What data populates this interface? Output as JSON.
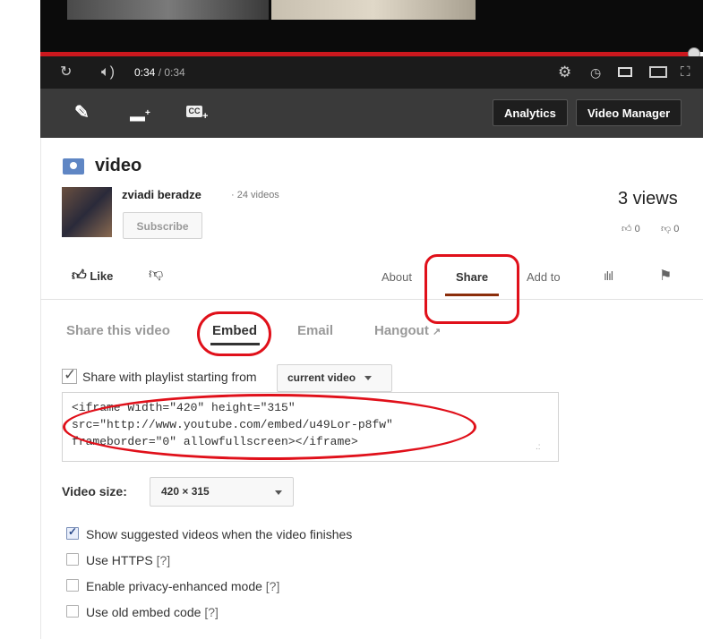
{
  "player": {
    "current_time": "0:34",
    "separator": " / ",
    "duration": "0:34",
    "progress_fraction": 1.0
  },
  "creator_bar": {
    "analytics_label": "Analytics",
    "video_manager_label": "Video Manager"
  },
  "video": {
    "title": "video",
    "channel_name": "zviadi beradze",
    "videos_count": "· 24 videos",
    "subscribe_label": "Subscribe",
    "views": "3 views",
    "like_count": "0",
    "dislike_count": "0"
  },
  "actions": {
    "like_label": "Like",
    "tabs": [
      {
        "label": "About"
      },
      {
        "label": "Share"
      },
      {
        "label": "Add to"
      }
    ],
    "active_tab": "Share"
  },
  "share": {
    "subtabs": [
      {
        "label": "Share this video"
      },
      {
        "label": "Embed"
      },
      {
        "label": "Email"
      },
      {
        "label": "Hangout"
      }
    ],
    "active_subtab": "Embed",
    "playlist_label": "Share with playlist starting from",
    "playlist_option": "current video",
    "embed_code_lines": [
      "<iframe width=\"420\" height=\"315\"",
      "src=\"http://www.youtube.com/embed/u49Lor-p8fw\"",
      "frameborder=\"0\" allowfullscreen></iframe>"
    ],
    "video_size_label": "Video size:",
    "video_size_value": "420 × 315",
    "options": [
      {
        "label": "Show suggested videos when the video finishes",
        "checked": true,
        "help": ""
      },
      {
        "label": "Use HTTPS",
        "checked": false,
        "help": "[?]"
      },
      {
        "label": "Enable privacy-enhanced mode",
        "checked": false,
        "help": "[?]"
      },
      {
        "label": "Use old embed code",
        "checked": false,
        "help": "[?]"
      }
    ]
  },
  "colors": {
    "accent_red": "#cc181e",
    "annotation_red": "#e0101a",
    "share_underline": "#8b2e0b"
  }
}
